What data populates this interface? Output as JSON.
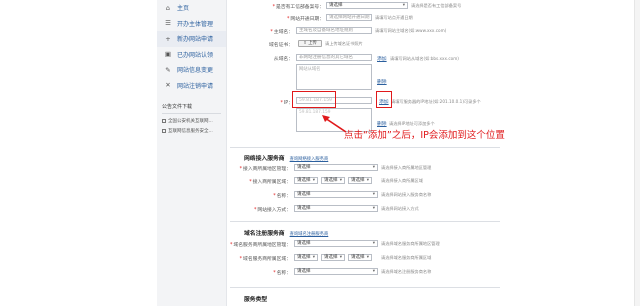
{
  "sidebar": {
    "items": [
      {
        "icon": "home-icon",
        "glyph": "⌂",
        "label": "主页"
      },
      {
        "icon": "list-icon",
        "glyph": "☰",
        "label": "开办主体管理"
      },
      {
        "icon": "plus-icon",
        "glyph": "+",
        "label": "新办网站申请"
      },
      {
        "icon": "save-icon",
        "glyph": "▣",
        "label": "已办网站认领"
      },
      {
        "icon": "edit-icon",
        "glyph": "✎",
        "label": "网站信息变更"
      },
      {
        "icon": "close-icon",
        "glyph": "✕",
        "label": "网站注销申请"
      }
    ],
    "docs_header": "公告文件下载",
    "docs": [
      "全国公安机关互联网...",
      "互联网信息服务安全..."
    ]
  },
  "form": {
    "q_stored": {
      "label": "是否有工信部备案号：",
      "value": "请选择",
      "hint": "请选择是否有工信部备案号"
    },
    "open_date": {
      "label": "网站开通日期：",
      "placeholder": "请选择网站开通日期",
      "hint": "请填写站点开通日期"
    },
    "domain": {
      "label": "主域名：",
      "placeholder": "主域名及自备域名地址规则",
      "hint": "请填写网站主域名(如:www.xxx.com)"
    },
    "cert": {
      "label": "域名证书：",
      "button": "上传",
      "hint": "请上传域名证书照片"
    },
    "sub_domain": {
      "label": "从域名：",
      "placeholder": "非网站注册信息的其它域名",
      "add": "添加",
      "hint": "请填写网站从域名(如:bbs.xxx.com)"
    },
    "sub_domain_list": {
      "placeholder": "网站从域名"
    },
    "ip": {
      "label": "IP：",
      "value": "59.81.187.159",
      "add": "添加",
      "hint": "请填写服务器的IP地址(如:201.10.0.1)可录多个",
      "placeholder": "网站IP"
    },
    "ip_list": {
      "placeholder": "网站IP",
      "value": "59.81.187.159"
    }
  },
  "callout": {
    "text": "点击“添加”之后，IP会添加到这个位置"
  },
  "section_access": {
    "title": "网络接入服务商",
    "link": "查询网络接入服务商",
    "rows": [
      {
        "label": "接入商所属地区管理：",
        "value": "请选择",
        "hint": "请选择接入商所属地区管理"
      },
      {
        "label": "接入商所属区域：",
        "v1": "请选择",
        "v2": "请选择",
        "v3": "请选择",
        "hint": "请选择接入商所属区域"
      },
      {
        "label": "名称：",
        "value": "请选择",
        "hint": "请选择网站接入服务商名称"
      },
      {
        "label": "网站接入方式：",
        "value": "请选择",
        "hint": "请选择网站接入方式"
      }
    ]
  },
  "section_domain": {
    "title": "域名注册服务商",
    "link": "查询域名注册服务商",
    "rows": [
      {
        "label": "域名服务商所属地区管理：",
        "value": "请选择",
        "hint": "请选择域名服务商所属地区管理"
      },
      {
        "label": "域名服务商所属区域：",
        "v1": "请选择",
        "v2": "请选择",
        "v3": "请选择",
        "hint": "请选择域名服务商所属区域"
      },
      {
        "label": "名称：",
        "value": "请选择",
        "hint": "请选择域名注册服务商名称"
      }
    ]
  },
  "section_service": {
    "title": "服务类型"
  },
  "colors": {
    "accent": "#2b5f9e",
    "highlight": "#e0191b"
  }
}
